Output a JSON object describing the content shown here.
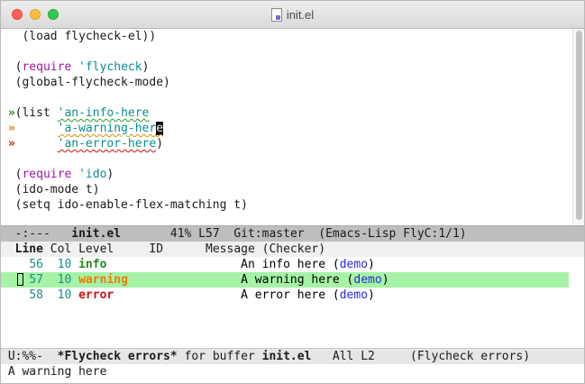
{
  "window": {
    "title": "init.el"
  },
  "code": {
    "line1": "(load flycheck-el))",
    "line2_kw": "require",
    "line2_const": "'flycheck",
    "line3": "(global-flycheck-mode)",
    "line4_kw": "list",
    "line4_const": "'an-info-here",
    "line5_const": "'a-warning-her",
    "line5_cursor": "e",
    "line6_const": "'an-error-here",
    "line7_kw": "require",
    "line7_const": "'ido",
    "line8": "(ido-mode t)",
    "line9": "(setq ido-enable-flex-matching t)"
  },
  "fringe": {
    "info": "»",
    "warning": "»",
    "error": "»"
  },
  "modeline_top": {
    "state": "-:---",
    "buffer": "init.el",
    "position": "41% L57",
    "vc": "Git:master",
    "modes": "(Emacs-Lisp FlyC:1/1)"
  },
  "errors": {
    "headers": {
      "line": "Line",
      "col": "Col",
      "level": "Level",
      "id": "ID",
      "message": "Message (Checker)"
    },
    "rows": [
      {
        "line": "56",
        "col": "10",
        "level": "info",
        "message": "An info here",
        "checker": "demo"
      },
      {
        "line": "57",
        "col": "10",
        "level": "warning",
        "message": "A warning here",
        "checker": "demo"
      },
      {
        "line": "58",
        "col": "10",
        "level": "error",
        "message": "A error here",
        "checker": "demo"
      }
    ]
  },
  "modeline_bottom": {
    "state": "U:%%-",
    "buffer": "*Flycheck errors*",
    "for_text": "for buffer",
    "target": "init.el",
    "position": "All L2",
    "mode": "(Flycheck errors)"
  },
  "echo_area": "A warning here",
  "colors": {
    "selected_row": "#a6f2a6",
    "info": "#1e8c1e",
    "warning": "#ee7a00",
    "error": "#d01010"
  }
}
